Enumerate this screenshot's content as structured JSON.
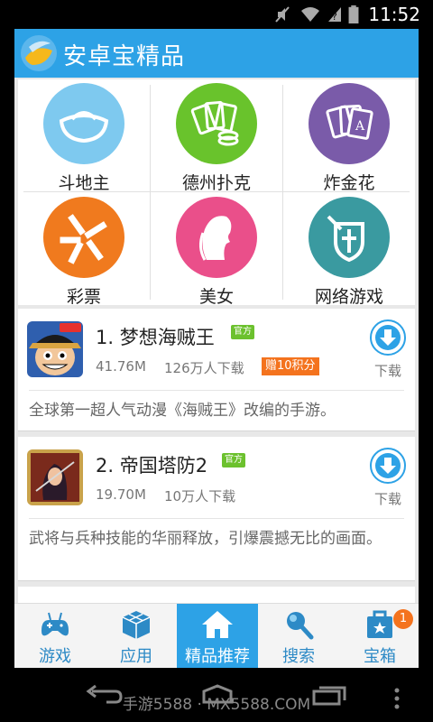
{
  "status_bar": {
    "time": "11:52"
  },
  "app_bar": {
    "title": "安卓宝精品"
  },
  "categories": [
    {
      "label": "斗地主",
      "icon": "gold-ingot-icon",
      "color": "#7ec9ef"
    },
    {
      "label": "德州扑克",
      "icon": "cards-chips-icon",
      "color": "#69c32c"
    },
    {
      "label": "炸金花",
      "icon": "playing-cards-icon",
      "color": "#7a5ba9"
    },
    {
      "label": "彩票",
      "icon": "lottery-icon",
      "color": "#f07a1e"
    },
    {
      "label": "美女",
      "icon": "woman-silhouette-icon",
      "color": "#ea4f8a"
    },
    {
      "label": "网络游戏",
      "icon": "shield-sword-icon",
      "color": "#3a9aa0"
    }
  ],
  "apps": [
    {
      "rank_name": "1. 梦想海贼王",
      "badge": "官方",
      "size": "41.76M",
      "downloads": "126万人下载",
      "gift": "赠10积分",
      "download_label": "下载",
      "description": "全球第一超人气动漫《海贼王》改编的手游。"
    },
    {
      "rank_name": "2. 帝国塔防2",
      "badge": "官方",
      "size": "19.70M",
      "downloads": "10万人下载",
      "download_label": "下载",
      "description": "武将与兵种技能的华丽释放，引爆震撼无比的画面。"
    }
  ],
  "tabs": [
    {
      "label": "游戏",
      "icon": "gamepad-icon"
    },
    {
      "label": "应用",
      "icon": "cube-icon"
    },
    {
      "label": "精品推荐",
      "icon": "home-icon",
      "active": true
    },
    {
      "label": "搜索",
      "icon": "search-icon"
    },
    {
      "label": "宝箱",
      "icon": "treasure-box-icon",
      "badge": "1"
    }
  ],
  "nav_bar": {
    "watermark": "手游5588 · MX5588.COM"
  },
  "colors": {
    "accent": "#2da2e6",
    "orange": "#f4731e",
    "green_badge": "#6cc12e"
  }
}
